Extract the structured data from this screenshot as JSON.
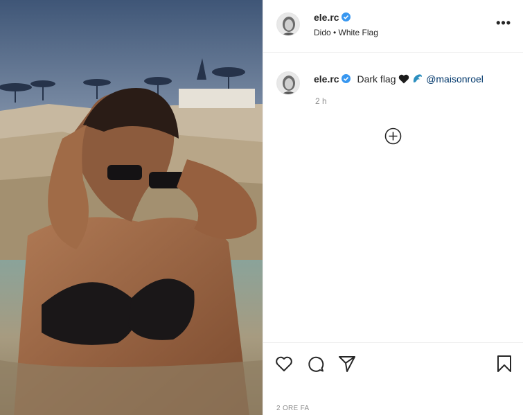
{
  "post": {
    "username": "ele.rc",
    "audio": "Dido • White Flag",
    "caption_text": "Dark flag",
    "mention": "@maisonroel",
    "comment_time": "2 h",
    "date": "2 ORE FA"
  },
  "icons": {
    "verified": "verified-badge-icon",
    "more": "more-options-icon",
    "load_more": "plus-circle-icon",
    "like": "heart-icon",
    "comment": "comment-icon",
    "share": "share-icon",
    "save": "bookmark-icon"
  },
  "colors": {
    "verified": "#3897f0",
    "mention": "#00376b",
    "muted": "#8e8e8e"
  }
}
